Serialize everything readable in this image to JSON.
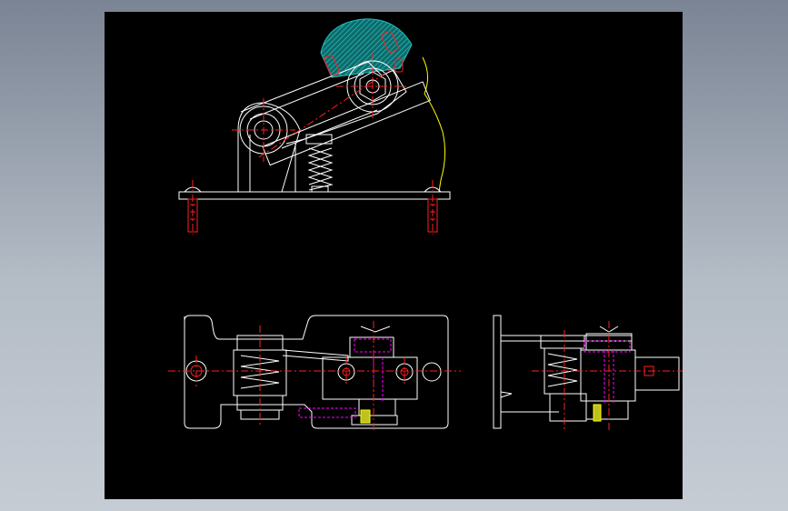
{
  "viewer": {
    "background_colors": [
      "#7a8494",
      "#c6ccd4"
    ],
    "viewport_color": "#000000"
  },
  "drawing": {
    "line_colors": {
      "outline": "#ffffff",
      "centerline": "#ff2020",
      "hidden": "#ff00ff",
      "break_line": "#ffff00",
      "hatch": "#20c0c0",
      "hatch_fill": "#0e6a6a"
    },
    "views": [
      "front-view",
      "top-view",
      "side-view"
    ]
  }
}
